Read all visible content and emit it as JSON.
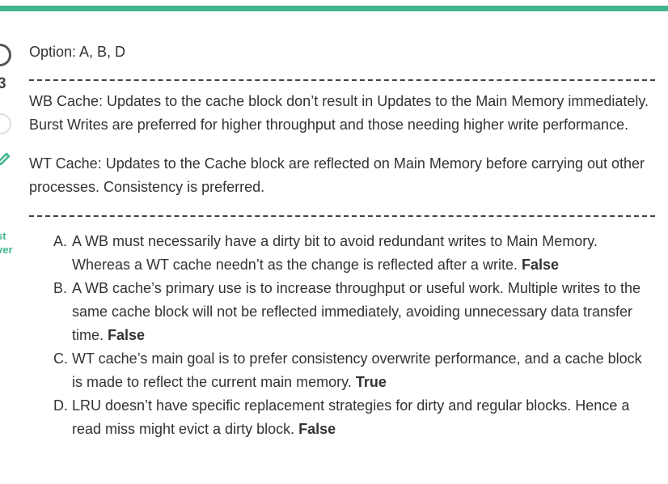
{
  "accent_color": "#40b58a",
  "gutter": {
    "number": "3",
    "word_top": "st",
    "word_bottom": "ver"
  },
  "option": "Option: A, B, D",
  "explanations": [
    "WB Cache: Updates to the cache block don’t result in Updates to the Main Memory immediately. Burst Writes are preferred for higher throughput and those needing higher write performance.",
    "WT Cache: Updates to the Cache block are reflected on Main Memory before carrying out other processes. Consistency is preferred."
  ],
  "answers": [
    {
      "letter": "A.",
      "text": "A WB must necessarily have a dirty bit to avoid redundant writes to Main Memory. Whereas a WT cache needn’t as the change is reflected after a write.",
      "verdict": "False"
    },
    {
      "letter": "B.",
      "text": "A WB cache’s primary use is to increase throughput or useful work. Multiple writes to the same cache block will not be reflected immediately, avoiding unnecessary data transfer time.",
      "verdict": "False"
    },
    {
      "letter": "C.",
      "text": "WT cache’s main goal is to prefer consistency overwrite performance, and a cache block is made to reflect the current main memory.",
      "verdict": "True"
    },
    {
      "letter": "D.",
      "text": "LRU doesn’t have specific replacement strategies for dirty and regular blocks. Hence a read miss might evict a dirty block.",
      "verdict": "False"
    }
  ]
}
